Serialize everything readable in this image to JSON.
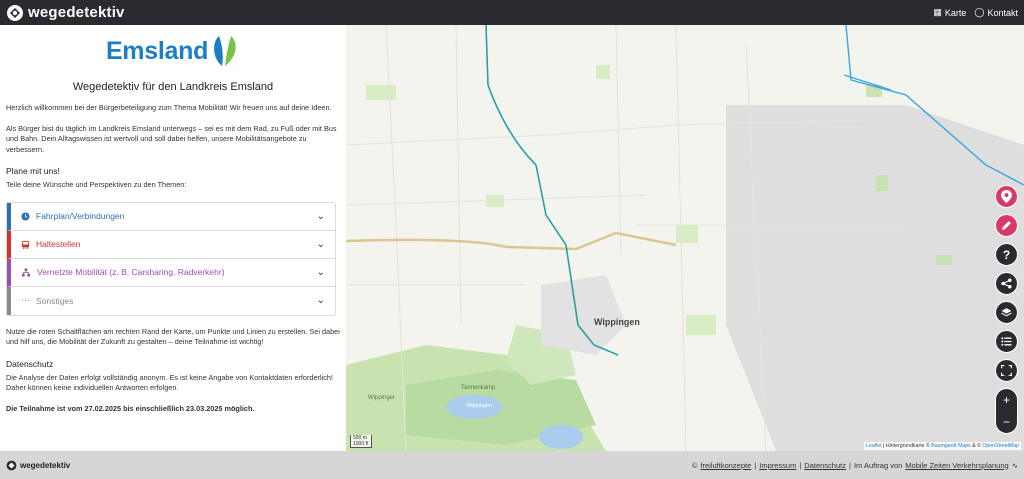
{
  "header": {
    "brand": "wegedetektiv",
    "nav": [
      {
        "label": "Karte"
      },
      {
        "label": "Kontakt"
      }
    ]
  },
  "sidebar": {
    "logo_text": "Emsland",
    "title": "Wegedetektiv für den Landkreis Emsland",
    "intro": "Herzlich willkommen bei der Bürgerbeteiligung zum Thema Mobilität! Wir freuen uns auf deine Ideen.",
    "para2": "Als Bürger bist du täglich im Landkreis Emsland unterwegs – sei es mit dem Rad, zu Fuß oder mit Bus und Bahn. Dein Alltagswissen ist wertvoll und soll dabei helfen, unsere Mobilitätsangebote zu verbessern.",
    "plan_heading": "Plane mit uns!",
    "plan_sub": "Teile deine Wünsche und Perspektiven zu den Themen:",
    "topics": [
      {
        "label": "Fahrplan/Verbindungen",
        "color": "#2f6fb3",
        "icon": "clock-icon"
      },
      {
        "label": "Haltestellen",
        "color": "#d0342c",
        "icon": "bus-icon"
      },
      {
        "label": "Vernetzte Mobilität (z. B. Carsharing, Radverkehr)",
        "color": "#9b4fb0",
        "icon": "network-icon"
      },
      {
        "label": "Sonstiges",
        "color": "#8a8a8a",
        "icon": "dots-icon"
      }
    ],
    "para3": "Nutze die roten Schaltflächen am rechten Rand der Karte, um Punkte und Linien zu erstellen. Sei dabei und hilf uns, die Mobilität der Zukunft zu gestalten – deine Teilnahme ist wichtig!",
    "privacy_heading": "Datenschutz",
    "privacy_text": "Die Analyse der Daten erfolgt vollständig anonym. Es ist keine Angabe von Kontaktdaten erforderlich! Daher können keine individuellen Antworten erfolgen.",
    "period": "Die Teilnahme ist vom 27.02.2025 bis einschließlich 23.03.2025 möglich."
  },
  "map": {
    "labels": {
      "town": "Wippingen",
      "area1": "Tannenkamp",
      "area2": "Wippinger",
      "area3": "Wippingen"
    },
    "scale": {
      "metric": "500 m",
      "imperial": "1000 ft"
    },
    "attribution": {
      "leaflet": "Leaflet",
      "sep1": " | Hintergrundkarte © ",
      "baumgardt": "Baumgardt Maps",
      "sep2": " & © ",
      "osm": "OpenStreetMap"
    },
    "controls": [
      "marker-icon",
      "pencil-icon",
      "help-icon",
      "share-icon",
      "layers-icon",
      "list-icon",
      "fullscreen-icon"
    ],
    "zoom_in": "+",
    "zoom_out": "−"
  },
  "footer": {
    "brand": "wegedetektiv",
    "copyright": "©",
    "link1": "freiluftkonzepte",
    "link2": "Impressum",
    "link3": "Datenschutz",
    "commission": "Im Auftrag von",
    "link4": "Mobile Zeiten Verkehrsplanung"
  },
  "colors": {
    "accent": "#d83a67",
    "dark": "#2b2a30",
    "brand_blue": "#1d7fc2"
  }
}
